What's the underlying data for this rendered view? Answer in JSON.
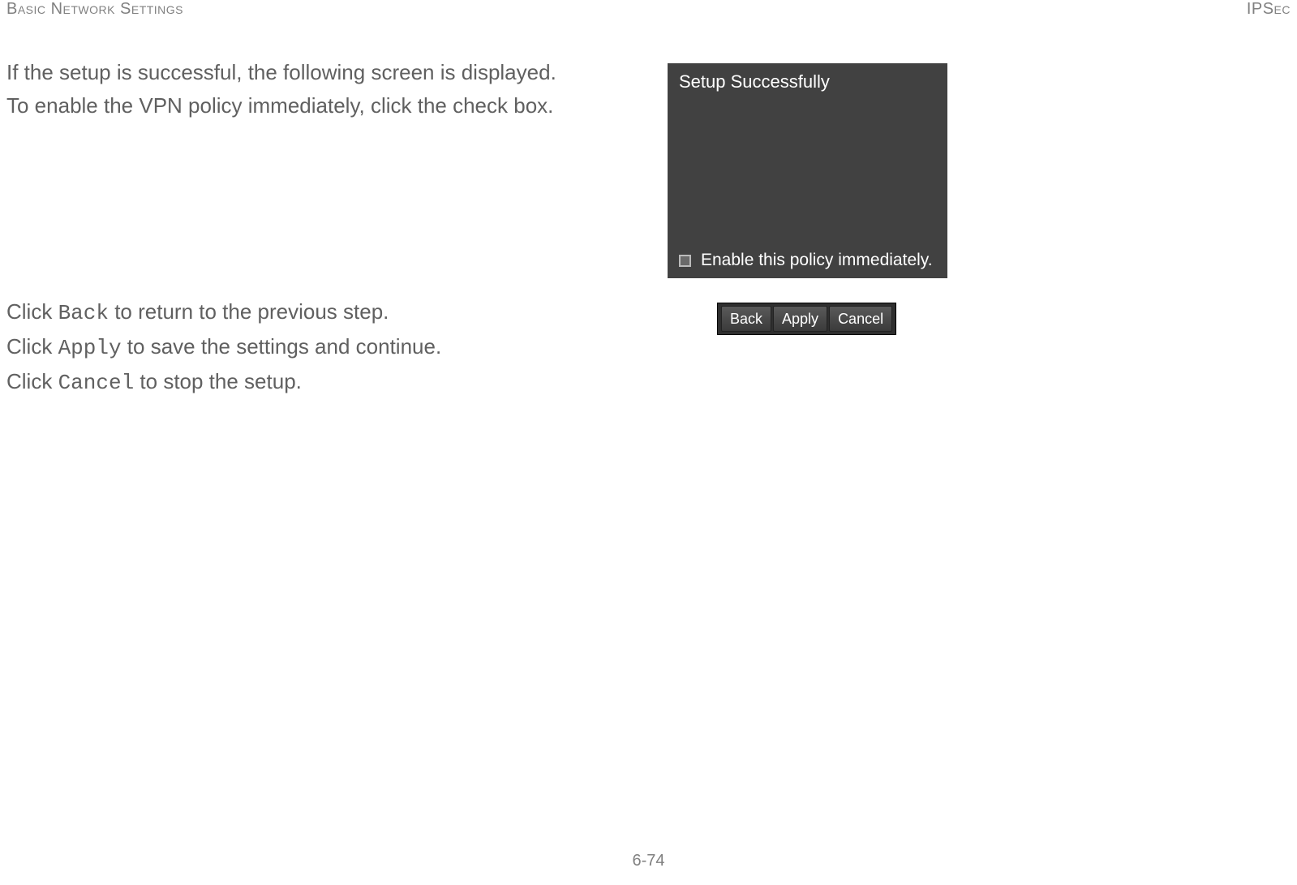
{
  "header": {
    "left": "Basic Network Settings",
    "right": "IPSec"
  },
  "intro": {
    "line1": "If the setup is successful, the following screen is displayed.",
    "line2": "To enable the VPN policy immediately, click the check box."
  },
  "panel": {
    "title": "Setup Successfully",
    "checkbox_label": "Enable this policy immediately."
  },
  "instructions": {
    "back": {
      "prefix": "Click ",
      "cmd": "Back",
      "suffix": " to return to the previous step."
    },
    "apply": {
      "prefix": "Click ",
      "cmd": "Apply",
      "suffix": " to save the settings and continue."
    },
    "cancel": {
      "prefix": "Click ",
      "cmd": "Cancel",
      "suffix": " to stop the setup."
    }
  },
  "buttons": {
    "back": "Back",
    "apply": "Apply",
    "cancel": "Cancel"
  },
  "footer": {
    "page": "6-74"
  }
}
